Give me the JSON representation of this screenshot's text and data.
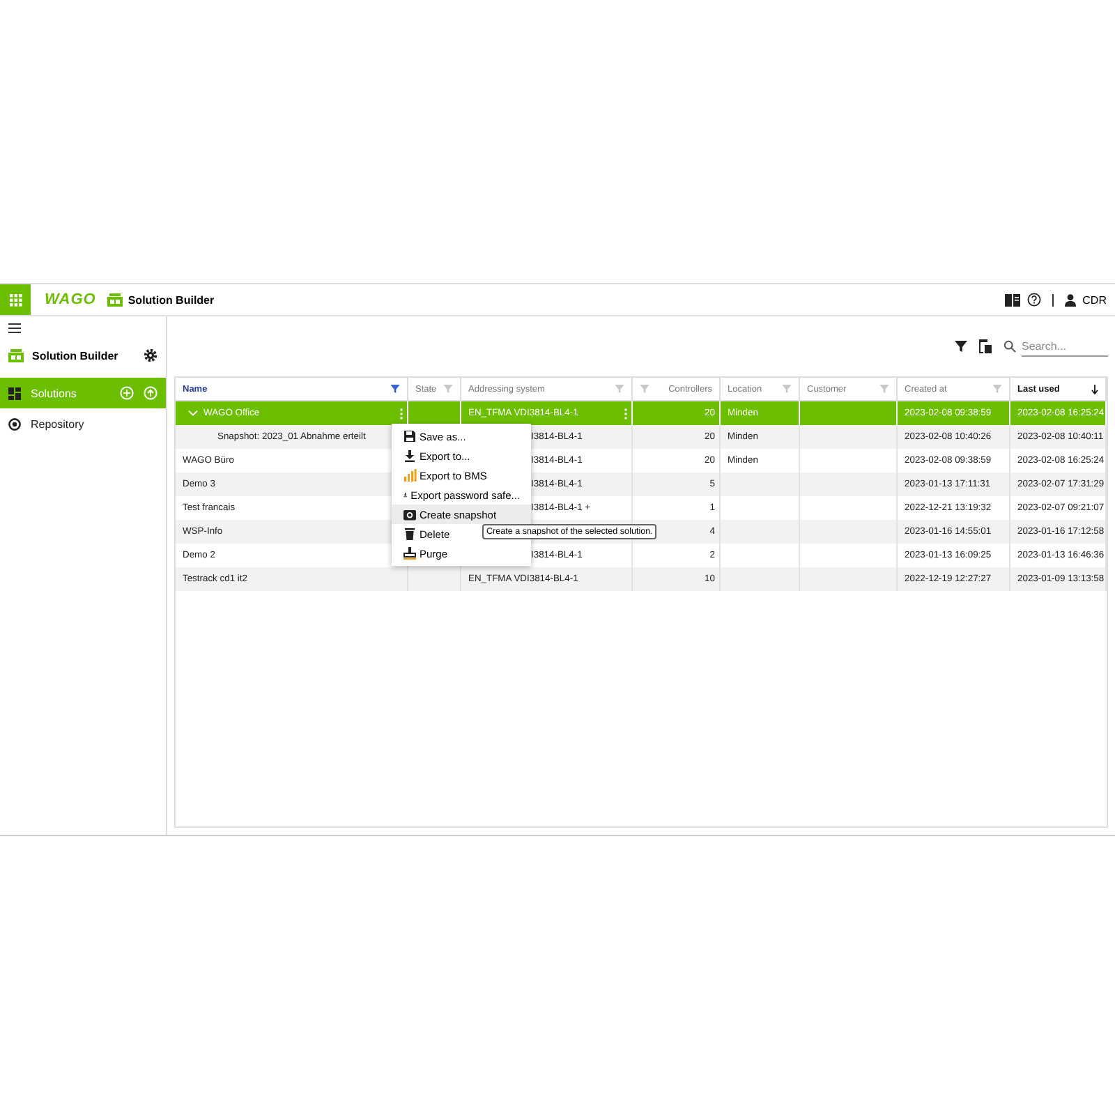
{
  "header": {
    "brand": "WAGO",
    "app_title": "Solution Builder",
    "user": "CDR"
  },
  "sidebar": {
    "title": "Solution Builder",
    "items": [
      {
        "label": "Solutions",
        "selected": true
      },
      {
        "label": "Repository",
        "selected": false
      }
    ]
  },
  "toolbar": {
    "search": {
      "placeholder": "Search..."
    }
  },
  "table": {
    "columns": [
      {
        "label": "Name",
        "kind": "text",
        "filter_active": true,
        "sorted": false
      },
      {
        "label": "State",
        "kind": "text",
        "filter_active": false,
        "sorted": false
      },
      {
        "label": "Addressing system",
        "kind": "text",
        "filter_active": false,
        "sorted": false
      },
      {
        "label": "Controllers",
        "kind": "number",
        "filter_active": false,
        "sorted": false
      },
      {
        "label": "Location",
        "kind": "text",
        "filter_active": false,
        "sorted": false
      },
      {
        "label": "Customer",
        "kind": "text",
        "filter_active": false,
        "sorted": false
      },
      {
        "label": "Created at",
        "kind": "text",
        "filter_active": false,
        "sorted": false
      },
      {
        "label": "Last used",
        "kind": "text",
        "filter_active": false,
        "sorted": true
      }
    ],
    "rows": [
      {
        "kind": "solution",
        "name": "WAGO Office",
        "expanded": true,
        "selected": true,
        "addressing": "EN_TFMA VDI3814-BL4-1",
        "controllers": "20",
        "location": "Minden",
        "created": "2023-02-08 09:38:59",
        "last_used": "2023-02-08 16:25:24"
      },
      {
        "kind": "snapshot",
        "name": "Snapshot: 2023_01 Abnahme erteilt",
        "selected": false,
        "addressing": "I3814-BL4-1",
        "controllers": "20",
        "location": "Minden",
        "created": "2023-02-08 10:40:26",
        "last_used": "2023-02-08 10:40:11"
      },
      {
        "kind": "solution",
        "name": "WAGO Büro",
        "selected": false,
        "addressing": "I3814-BL4-1",
        "controllers": "20",
        "location": "Minden",
        "created": "2023-02-08 09:38:59",
        "last_used": "2023-02-08 16:25:24"
      },
      {
        "kind": "solution",
        "name": "Demo 3",
        "selected": false,
        "addressing": "I3814-BL4-1",
        "controllers": "5",
        "created": "2023-01-13 17:11:31",
        "last_used": "2023-02-07 17:31:29"
      },
      {
        "kind": "solution",
        "name": "Test francais",
        "selected": false,
        "addressing": "I3814-BL4-1 +",
        "controllers": "1",
        "created": "2022-12-21 13:19:32",
        "last_used": "2023-02-07 09:21:07"
      },
      {
        "kind": "solution",
        "name": "WSP-Info",
        "selected": false,
        "controllers": "4",
        "created": "2023-01-16 14:55:01",
        "last_used": "2023-01-16 17:12:58"
      },
      {
        "kind": "solution",
        "name": "Demo 2",
        "selected": false,
        "addressing": "I3814-BL4-1",
        "controllers": "2",
        "created": "2023-01-13 16:09:25",
        "last_used": "2023-01-13 16:46:36"
      },
      {
        "kind": "solution",
        "name": "Testrack cd1 it2",
        "selected": false,
        "addressing": "EN_TFMA VDI3814-BL4-1",
        "controllers": "10",
        "created": "2022-12-19 12:27:27",
        "last_used": "2023-01-09 13:13:58"
      }
    ]
  },
  "context_menu": {
    "items": [
      {
        "label": "Save as...",
        "selected": false
      },
      {
        "label": "Export to...",
        "selected": false
      },
      {
        "label": "Export to BMS",
        "selected": false
      },
      {
        "label": "Export password safe...",
        "selected": false
      },
      {
        "label": "Create snapshot",
        "selected": true
      },
      {
        "label": "Delete",
        "selected": false
      },
      {
        "label": "Purge",
        "selected": false
      }
    ]
  },
  "tooltip": "Create a snapshot of the selected solution."
}
